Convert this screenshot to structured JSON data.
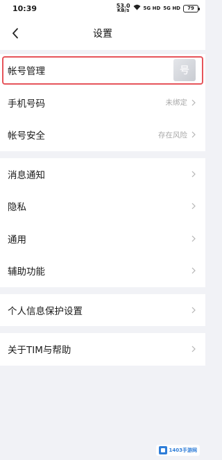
{
  "status_bar": {
    "time": "10:39",
    "net_speed_value": "53.0",
    "net_speed_unit": "KB/s",
    "signal1": "5G HD",
    "signal2": "5G HD",
    "battery": "79"
  },
  "nav": {
    "title": "设置"
  },
  "groups": [
    {
      "rows": [
        {
          "label": "帐号管理",
          "value": "",
          "has_avatar": true,
          "highlighted": true
        },
        {
          "label": "手机号码",
          "value": "未绑定"
        },
        {
          "label": "帐号安全",
          "value": "存在风险"
        }
      ]
    },
    {
      "rows": [
        {
          "label": "消息通知"
        },
        {
          "label": "隐私"
        },
        {
          "label": "通用"
        },
        {
          "label": "辅助功能"
        }
      ]
    },
    {
      "rows": [
        {
          "label": "个人信息保护设置"
        }
      ]
    },
    {
      "rows": [
        {
          "label": "关于TIM与帮助"
        }
      ]
    }
  ],
  "avatar_glyph": "号",
  "watermark": {
    "text": "1403手游网"
  },
  "colors": {
    "highlight": "#e6545a",
    "background": "#f1f2f6"
  }
}
